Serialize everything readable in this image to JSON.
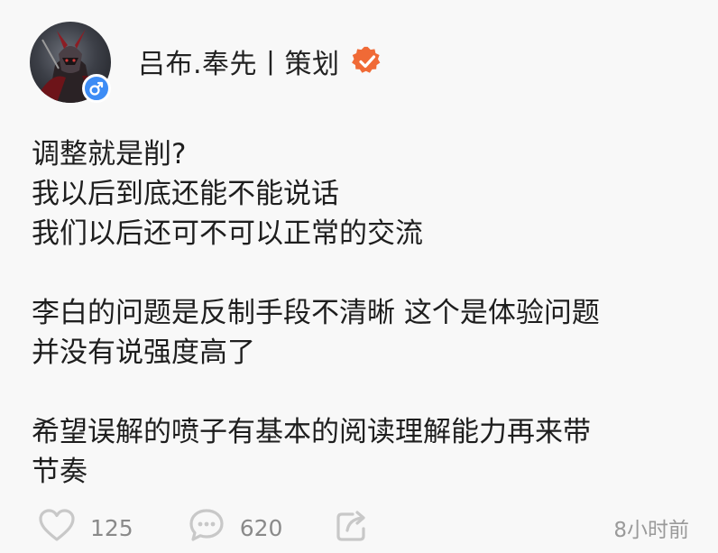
{
  "user": {
    "name": "吕布.奉先丨策划",
    "avatar": "game-hero-avatar",
    "gender_icon": "male-icon",
    "verified_icon": "verified-badge-icon",
    "verified_color": "#f06a36",
    "gender_badge_color": "#3d8cf5"
  },
  "post": {
    "lines": [
      "调整就是削?",
      "我以后到底还能不能说话",
      "我们以后还可不可以正常的交流",
      "",
      "李白的问题是反制手段不清晰 这个是体验问题",
      "并没有说强度高了",
      "",
      "希望误解的喷子有基本的阅读理解能力再来带",
      "节奏"
    ]
  },
  "actions": {
    "like_count": "125",
    "comment_count": "620",
    "like_icon": "heart-icon",
    "comment_icon": "comment-bubble-icon",
    "share_icon": "share-icon",
    "icon_color": "#c8c8c8"
  },
  "meta": {
    "timestamp": "8小时前"
  }
}
